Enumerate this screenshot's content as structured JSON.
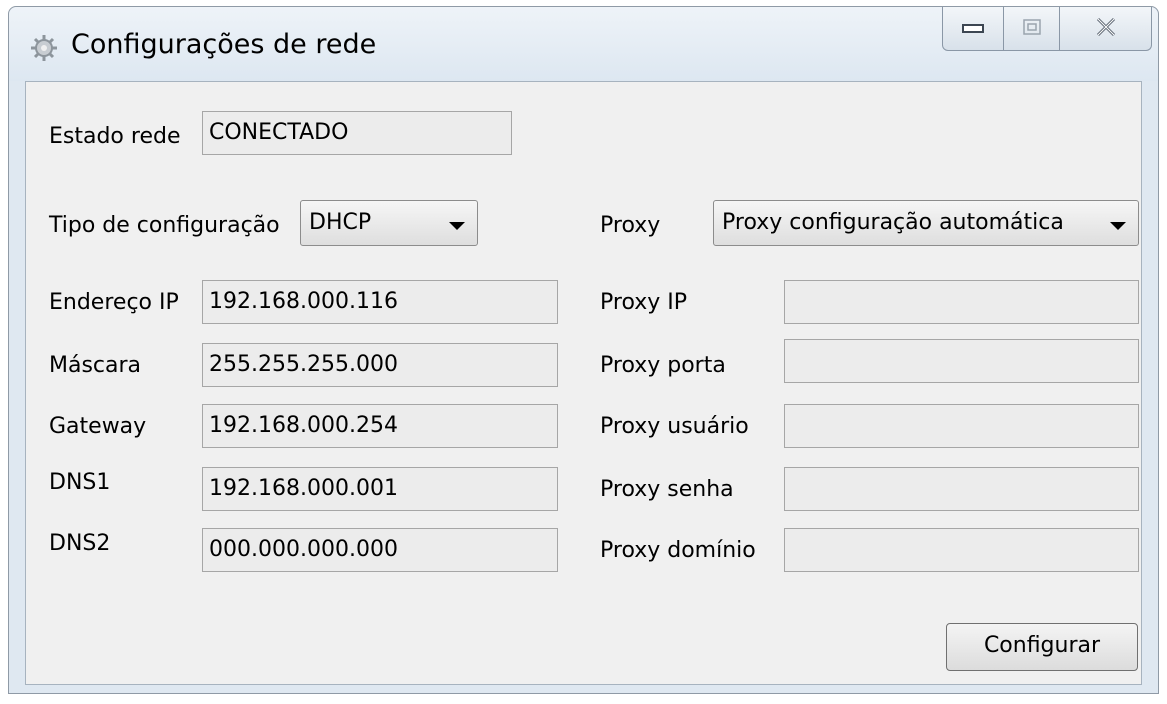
{
  "window": {
    "title": "Configurações de rede"
  },
  "form": {
    "estado_rede": {
      "label": "Estado rede",
      "value": "CONECTADO"
    },
    "tipo_configuracao": {
      "label": "Tipo de configuração",
      "selected": "DHCP"
    },
    "endereco_ip": {
      "label": "Endereço IP",
      "value": "192.168.000.116"
    },
    "mascara": {
      "label": "Máscara",
      "value": "255.255.255.000"
    },
    "gateway": {
      "label": "Gateway",
      "value": "192.168.000.254"
    },
    "dns1": {
      "label": "DNS1",
      "value": "192.168.000.001"
    },
    "dns2": {
      "label": "DNS2",
      "value": "000.000.000.000"
    },
    "proxy": {
      "label": "Proxy",
      "selected": "Proxy configuração automática"
    },
    "proxy_ip": {
      "label": "Proxy IP",
      "value": ""
    },
    "proxy_porta": {
      "label": "Proxy porta",
      "value": ""
    },
    "proxy_usuario": {
      "label": "Proxy usuário",
      "value": ""
    },
    "proxy_senha": {
      "label": "Proxy senha",
      "value": ""
    },
    "proxy_dominio": {
      "label": "Proxy domínio",
      "value": ""
    }
  },
  "actions": {
    "configurar_label": "Configurar"
  },
  "icons": {
    "app": "network-settings-icon",
    "minimize": "minimize-icon",
    "maximize": "maximize-icon",
    "close": "close-icon"
  }
}
